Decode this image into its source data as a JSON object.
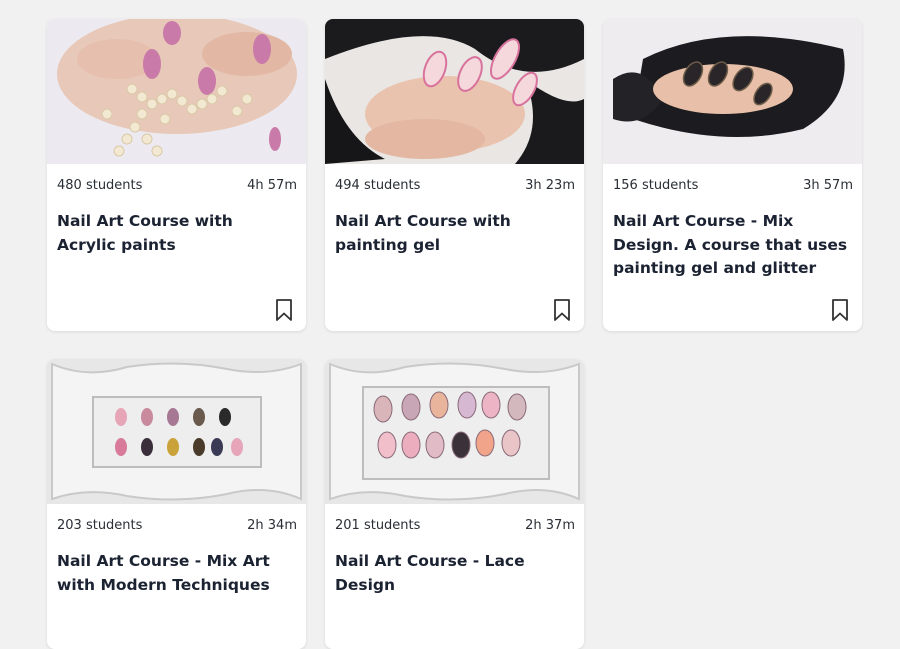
{
  "courses": [
    {
      "students": "480 students",
      "duration": "4h 57m",
      "title": "Nail Art Course with Acrylic paints",
      "image_icon": "pink-nails-pearls-image"
    },
    {
      "students": "494 students",
      "duration": "3h 23m",
      "title": "Nail Art Course with painting gel",
      "image_icon": "pink-nails-black-feather-image"
    },
    {
      "students": "156 students",
      "duration": "3h 57m",
      "title": "Nail Art Course - Mix Design. A course that uses painting gel and glitter",
      "image_icon": "dark-nails-black-feather-image"
    },
    {
      "students": "203 students",
      "duration": "2h 34m",
      "title": "Nail Art Course - Mix Art with Modern Techniques",
      "image_icon": "nail-tips-white-frame-image"
    },
    {
      "students": "201 students",
      "duration": "2h 37m",
      "title": "Nail Art Course - Lace Design",
      "image_icon": "lace-nail-tips-white-frame-image"
    }
  ],
  "bookmark_icon": "bookmark-icon",
  "colors": {
    "background": "#f1f1f1",
    "card": "#ffffff",
    "title_text": "#1b2232",
    "meta_text": "#2a2f36"
  }
}
